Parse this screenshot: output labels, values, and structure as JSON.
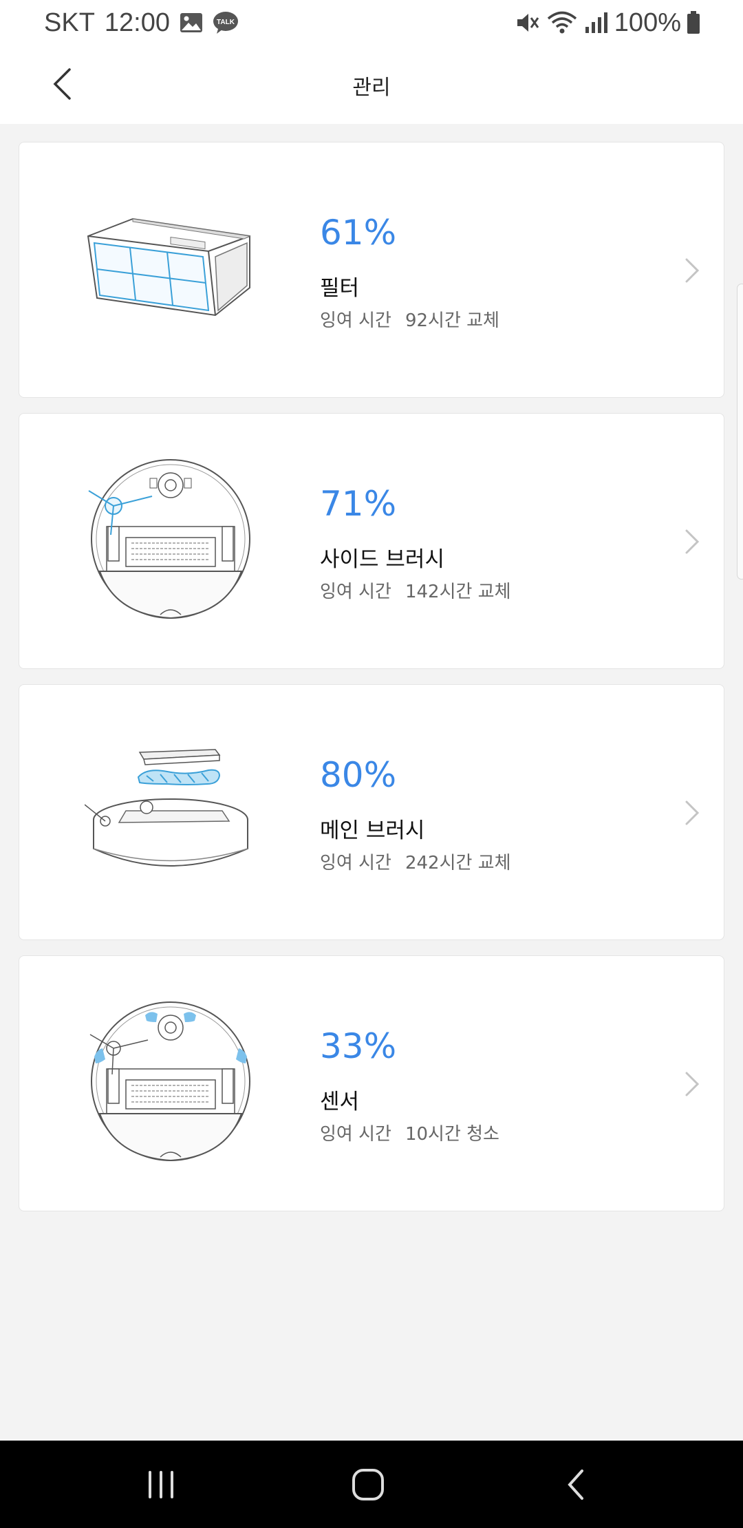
{
  "status_bar": {
    "carrier": "SKT",
    "time": "12:00",
    "battery": "100%",
    "icons_left": [
      "gallery-icon",
      "kakaotalk-icon"
    ],
    "icons_right": [
      "mute-icon",
      "wifi-icon",
      "signal-icon",
      "battery-icon"
    ]
  },
  "header": {
    "title": "관리"
  },
  "items": [
    {
      "percent": "61%",
      "name": "필터",
      "remain_label": "잉여 시간",
      "remain_value": "92시간 교체",
      "icon": "filter-image"
    },
    {
      "percent": "71%",
      "name": "사이드 브러시",
      "remain_label": "잉여 시간",
      "remain_value": "142시간 교체",
      "icon": "side-brush-image"
    },
    {
      "percent": "80%",
      "name": "메인 브러시",
      "remain_label": "잉여 시간",
      "remain_value": "242시간 교체",
      "icon": "main-brush-image"
    },
    {
      "percent": "33%",
      "name": "센서",
      "remain_label": "잉여 시간",
      "remain_value": "10시간 청소",
      "icon": "sensor-image"
    }
  ],
  "colors": {
    "accent": "#3a87e6",
    "background": "#f3f3f3",
    "card": "#ffffff",
    "navbar": "#000000"
  }
}
